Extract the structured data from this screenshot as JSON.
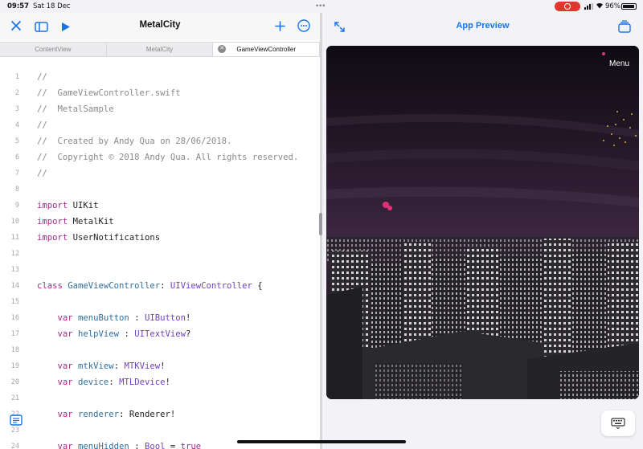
{
  "status": {
    "time": "09:57",
    "date": "Sat 18 Dec",
    "battery": "96%"
  },
  "editor": {
    "title": "MetalCity",
    "tabs": [
      {
        "label": "ContentView"
      },
      {
        "label": "MetalCity"
      },
      {
        "label": "GameViewController"
      }
    ],
    "lines": [
      {
        "n": "1",
        "parts": [
          {
            "t": "//",
            "c": "c-comment"
          }
        ]
      },
      {
        "n": "2",
        "parts": [
          {
            "t": "//  GameViewController.swift",
            "c": "c-comment"
          }
        ]
      },
      {
        "n": "3",
        "parts": [
          {
            "t": "//  MetalSample",
            "c": "c-comment"
          }
        ]
      },
      {
        "n": "4",
        "parts": [
          {
            "t": "//",
            "c": "c-comment"
          }
        ]
      },
      {
        "n": "5",
        "parts": [
          {
            "t": "//  Created by Andy Qua on 28/06/2018.",
            "c": "c-comment"
          }
        ]
      },
      {
        "n": "6",
        "parts": [
          {
            "t": "//  Copyright © 2018 Andy Qua. All rights reserved.",
            "c": "c-comment"
          }
        ]
      },
      {
        "n": "7",
        "parts": [
          {
            "t": "//",
            "c": "c-comment"
          }
        ]
      },
      {
        "n": "8",
        "parts": []
      },
      {
        "n": "9",
        "parts": [
          {
            "t": "import",
            "c": "c-kw"
          },
          {
            "t": " UIKit",
            "c": ""
          }
        ]
      },
      {
        "n": "10",
        "parts": [
          {
            "t": "import",
            "c": "c-kw"
          },
          {
            "t": " MetalKit",
            "c": ""
          }
        ]
      },
      {
        "n": "11",
        "parts": [
          {
            "t": "import",
            "c": "c-kw"
          },
          {
            "t": " UserNotifications",
            "c": ""
          }
        ]
      },
      {
        "n": "12",
        "parts": []
      },
      {
        "n": "13",
        "parts": []
      },
      {
        "n": "14",
        "parts": [
          {
            "t": "class",
            "c": "c-kw"
          },
          {
            "t": " GameViewController",
            "c": "c-ident"
          },
          {
            "t": ": ",
            "c": ""
          },
          {
            "t": "UIViewController",
            "c": "c-type"
          },
          {
            "t": " {",
            "c": ""
          }
        ]
      },
      {
        "n": "15",
        "parts": []
      },
      {
        "n": "16",
        "parts": [
          {
            "t": "    var",
            "c": "c-kw"
          },
          {
            "t": " menuButton",
            "c": "c-ident"
          },
          {
            "t": " : ",
            "c": ""
          },
          {
            "t": "UIButton",
            "c": "c-type"
          },
          {
            "t": "!",
            "c": ""
          }
        ]
      },
      {
        "n": "17",
        "parts": [
          {
            "t": "    var",
            "c": "c-kw"
          },
          {
            "t": " helpView",
            "c": "c-ident"
          },
          {
            "t": " : ",
            "c": ""
          },
          {
            "t": "UITextView",
            "c": "c-type"
          },
          {
            "t": "?",
            "c": ""
          }
        ]
      },
      {
        "n": "18",
        "parts": []
      },
      {
        "n": "19",
        "parts": [
          {
            "t": "    var",
            "c": "c-kw"
          },
          {
            "t": " mtkView",
            "c": "c-ident"
          },
          {
            "t": ": ",
            "c": ""
          },
          {
            "t": "MTKView",
            "c": "c-type"
          },
          {
            "t": "!",
            "c": ""
          }
        ]
      },
      {
        "n": "20",
        "parts": [
          {
            "t": "    var",
            "c": "c-kw"
          },
          {
            "t": " device",
            "c": "c-ident"
          },
          {
            "t": ": ",
            "c": ""
          },
          {
            "t": "MTLDevice",
            "c": "c-type"
          },
          {
            "t": "!",
            "c": ""
          }
        ]
      },
      {
        "n": "21",
        "parts": []
      },
      {
        "n": "22",
        "parts": [
          {
            "t": "    var",
            "c": "c-kw"
          },
          {
            "t": " renderer",
            "c": "c-ident"
          },
          {
            "t": ": ",
            "c": ""
          },
          {
            "t": "Renderer",
            "c": ""
          },
          {
            "t": "!",
            "c": ""
          }
        ]
      },
      {
        "n": "23",
        "parts": []
      },
      {
        "n": "24",
        "parts": [
          {
            "t": "    var",
            "c": "c-kw"
          },
          {
            "t": " menuHidden",
            "c": "c-ident"
          },
          {
            "t": " : ",
            "c": ""
          },
          {
            "t": "Bool",
            "c": "c-type"
          },
          {
            "t": " = ",
            "c": ""
          },
          {
            "t": "true",
            "c": "c-kw"
          }
        ]
      }
    ]
  },
  "preview": {
    "title": "App Preview",
    "menu_label": "Menu"
  }
}
